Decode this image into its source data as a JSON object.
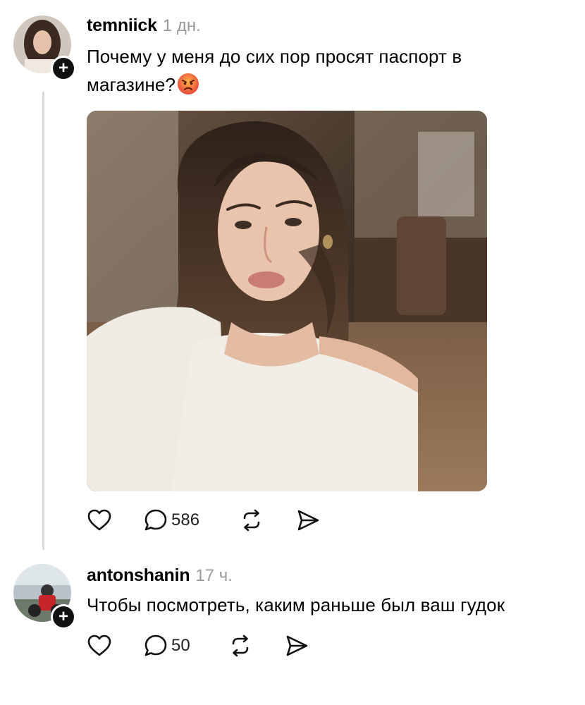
{
  "posts": [
    {
      "username": "temniick",
      "time": "1 дн.",
      "text": "Почему у меня до сих пор просят паспорт в магазине?",
      "emoji": "angry-face-emoji",
      "follow_badge": "+",
      "actions": {
        "like_icon": "heart-icon",
        "reply_icon": "comment-icon",
        "reply_count": "586",
        "repost_icon": "repost-icon",
        "share_icon": "send-icon"
      }
    },
    {
      "username": "antonshanin",
      "time": "17 ч.",
      "text": "Чтобы посмотреть, каким раньше был ваш гудок",
      "follow_badge": "+",
      "actions": {
        "like_icon": "heart-icon",
        "reply_icon": "comment-icon",
        "reply_count": "50",
        "repost_icon": "repost-icon",
        "share_icon": "send-icon"
      }
    }
  ],
  "colors": {
    "background": "#ffffff",
    "time_gray": "#9a9a9a",
    "thread_line": "#d9d9d9",
    "badge": "#111111"
  }
}
